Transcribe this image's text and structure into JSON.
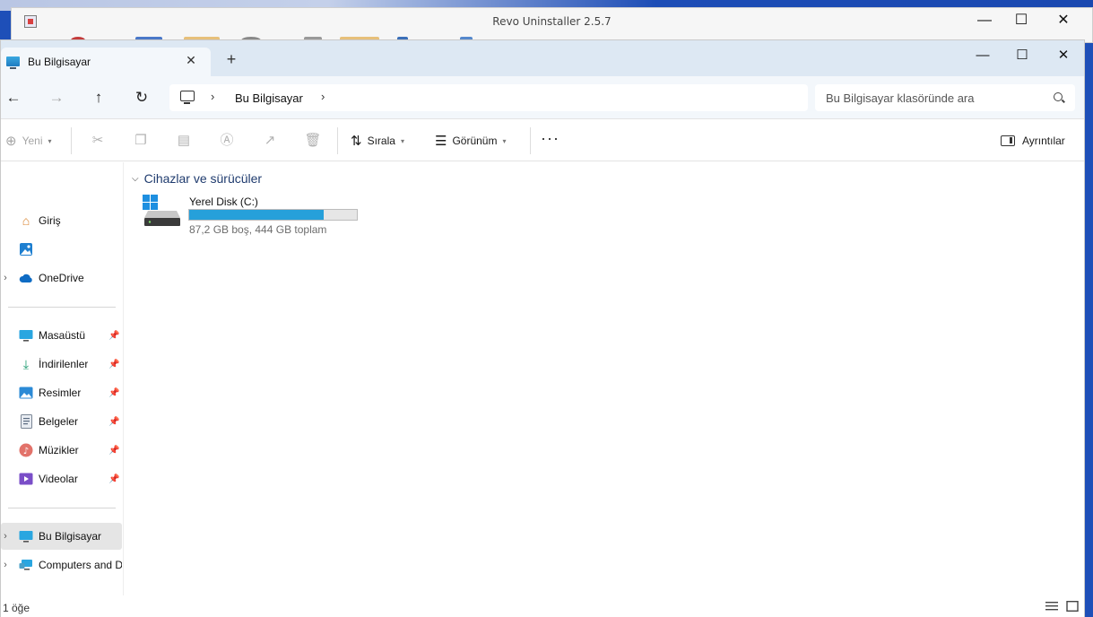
{
  "revo": {
    "title": "Revo Uninstaller 2.5.7",
    "minimize_glyph": "—",
    "maximize_glyph": "☐",
    "close_glyph": "✕"
  },
  "explorer": {
    "tab": {
      "label": "Bu Bilgisayar",
      "close_glyph": "✕"
    },
    "new_tab_glyph": "+",
    "window_controls": {
      "minimize": "—",
      "maximize": "☐",
      "close": "✕"
    },
    "nav": {
      "back": "←",
      "forward": "→",
      "up": "↑",
      "refresh": "↻"
    },
    "breadcrumb": {
      "separator": "›",
      "location": "Bu Bilgisayar",
      "trailing_separator": "›"
    },
    "search": {
      "placeholder": "Bu Bilgisayar klasöründe ara"
    },
    "toolbar": {
      "new_label": "Yeni",
      "sort_label": "Sırala",
      "view_label": "Görünüm",
      "more_label": "···",
      "details_label": "Ayrıntılar"
    },
    "sidebar": {
      "items": [
        {
          "label": "Giriş",
          "icon": "home-icon"
        },
        {
          "label": "",
          "icon": "gallery-icon"
        },
        {
          "label": "OneDrive",
          "icon": "onedrive-icon"
        },
        {
          "label": "Masaüstü",
          "icon": "desktop-icon"
        },
        {
          "label": "İndirilenler",
          "icon": "downloads-icon"
        },
        {
          "label": "Resimler",
          "icon": "pictures-icon"
        },
        {
          "label": "Belgeler",
          "icon": "documents-icon"
        },
        {
          "label": "Müzikler",
          "icon": "music-icon"
        },
        {
          "label": "Videolar",
          "icon": "videos-icon"
        },
        {
          "label": "Bu Bilgisayar",
          "icon": "this-pc-icon"
        },
        {
          "label": "Computers and D",
          "icon": "network-icon"
        }
      ]
    },
    "content": {
      "group_title": "Cihazlar ve sürücüler",
      "drive": {
        "name": "Yerel Disk (C:)",
        "info": "87,2 GB boş, 444 GB toplam",
        "used_fraction": 0.804
      }
    },
    "status": {
      "item_count": "1 öğe"
    },
    "colors": {
      "accent": "#26a0da",
      "tabbar": "#dde8f3",
      "group_title": "#1f3b6e"
    }
  }
}
